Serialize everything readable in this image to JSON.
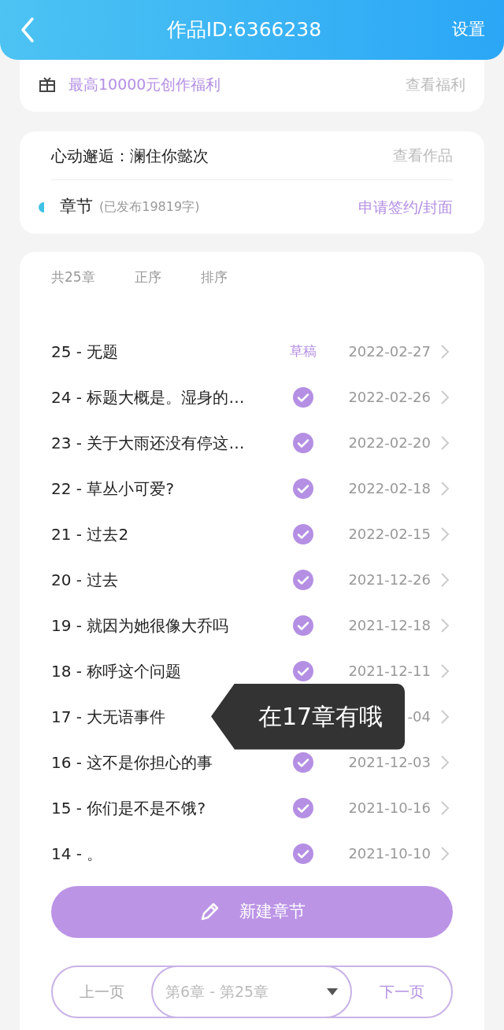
{
  "header": {
    "title": "作品ID:6366238",
    "action": "设置"
  },
  "benefit": {
    "text": "最高10000元创作福利",
    "link": "查看福利"
  },
  "work": {
    "title": "心动邂逅：澜住你懿次",
    "link": "查看作品",
    "section": "章节",
    "section_note": "(已发布19819字)",
    "action": "申请签约/封面"
  },
  "list_header": [
    "共25章",
    "正序",
    "排序"
  ],
  "chapters": [
    {
      "title": "25 - 无题",
      "kind": "draft",
      "status_text": "草稿",
      "date": "2022-02-27"
    },
    {
      "title": "24 - 标题大概是。湿身的…",
      "kind": "published",
      "date": "2022-02-26"
    },
    {
      "title": "23 - 关于大雨还没有停这…",
      "kind": "published",
      "date": "2022-02-20"
    },
    {
      "title": "22 - 草丛小可爱?",
      "kind": "published",
      "date": "2022-02-18"
    },
    {
      "title": "21 - 过去2",
      "kind": "published",
      "date": "2022-02-15"
    },
    {
      "title": "20 - 过去",
      "kind": "published",
      "date": "2021-12-26"
    },
    {
      "title": "19 - 就因为她很像大乔吗",
      "kind": "published",
      "date": "2021-12-18"
    },
    {
      "title": "18 - 称呼这个问题",
      "kind": "published",
      "date": "2021-12-11"
    },
    {
      "title": "17 - 大无语事件",
      "kind": "covered",
      "date": "-04"
    },
    {
      "title": "16 - 这不是你担心的事",
      "kind": "published",
      "date": "2021-12-03"
    },
    {
      "title": "15 - 你们是不是不饿?",
      "kind": "published",
      "date": "2021-10-16"
    },
    {
      "title": "14 - 。",
      "kind": "published",
      "date": "2021-10-10"
    }
  ],
  "tooltip": {
    "text": "在17章有哦"
  },
  "new_button": "新建章节",
  "pager": {
    "prev": "上一页",
    "range": "第6章 - 第25章",
    "next": "下一页"
  }
}
